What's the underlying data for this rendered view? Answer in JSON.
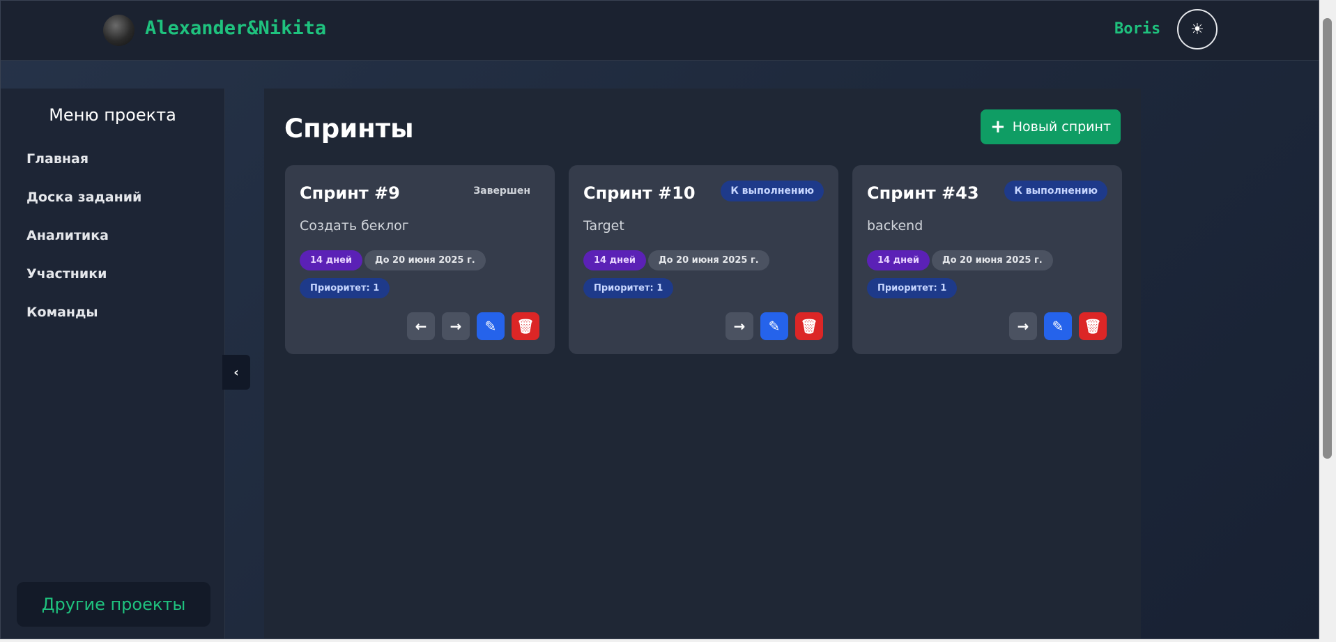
{
  "header": {
    "brand": "Alexander&Nikita",
    "user": "Boris",
    "theme_icon": "sun-icon"
  },
  "sidebar": {
    "title": "Меню проекта",
    "items": [
      {
        "label": "Главная"
      },
      {
        "label": "Доска заданий"
      },
      {
        "label": "Аналитика"
      },
      {
        "label": "Участники"
      },
      {
        "label": "Команды"
      }
    ],
    "other_projects": "Другие проекты"
  },
  "main": {
    "title": "Спринты",
    "new_sprint_label": "Новый спринт",
    "cards": [
      {
        "title": "Спринт #9",
        "status": "Завершен",
        "description": "Создать беклог",
        "days": "14 дней",
        "deadline": "До 20 июня 2025 г.",
        "priority": "Приоритет: 1"
      },
      {
        "title": "Спринт #10",
        "status": "К выполнению",
        "description": "Target",
        "days": "14 дней",
        "deadline": "До 20 июня 2025 г.",
        "priority": "Приоритет: 1"
      },
      {
        "title": "Спринт #43",
        "status": "К выполнению",
        "description": "backend",
        "days": "14 дней",
        "deadline": "До 20 июня 2025 г.",
        "priority": "Приоритет: 1"
      }
    ]
  },
  "colors": {
    "accent_green": "#1fc27e",
    "button_green": "#0f9d64",
    "edit_blue": "#2563eb",
    "delete_red": "#dc2626"
  }
}
